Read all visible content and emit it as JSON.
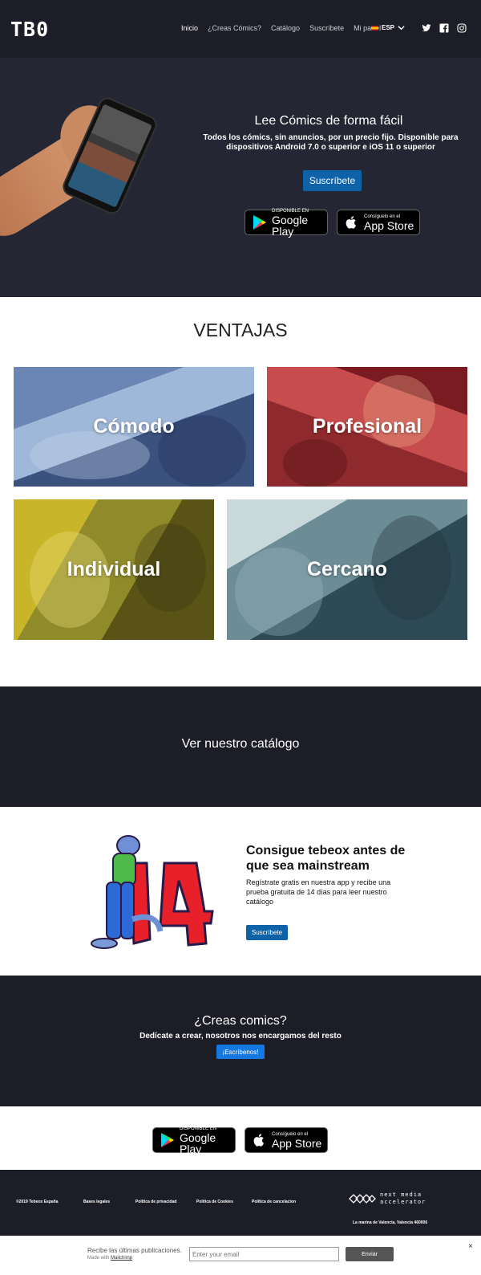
{
  "nav": {
    "logo": "TB0",
    "items": [
      "Inicio",
      "¿Creas Cómics?",
      "Catálogo",
      "Suscríbete",
      "Mi panel"
    ],
    "lang": "ESP",
    "social_icons": [
      "twitter-icon",
      "facebook-icon",
      "instagram-icon"
    ]
  },
  "hero": {
    "title": "Lee Cómics de forma fácil",
    "subtitle": "Todos los cómics, sin anuncios, por un precio fijo. Disponible para dispositivos Android 7.0 o superior e iOS 11 o superior",
    "button": "Suscríbete"
  },
  "stores": {
    "google_small": "DISPONIBLE EN",
    "google_big": "Google Play",
    "apple_small": "Consíguelo en el",
    "apple_big": "App Store"
  },
  "ventajas": {
    "title": "VENTAJAS",
    "tiles": [
      "Cómodo",
      "Profesional",
      "Individual",
      "Cercano"
    ]
  },
  "catalog": {
    "link": "Ver nuestro catálogo"
  },
  "trial": {
    "title": "Consigue tebeox antes de que sea mainstream",
    "subtitle": "Regístrate gratis en nuestra app y recibe una prueba gratuita de 14 días para leer nuestro catálogo",
    "button": "Suscríbete"
  },
  "creators": {
    "title": "¿Creas comics?",
    "subtitle": "Dedícate a crear, nosotros nos encargamos del resto",
    "button": "¡Escríbenos!"
  },
  "footer": {
    "links": [
      "©2019 Tebeox España",
      "Bases legales",
      "Política de privacidad",
      "Política de Cookies",
      "Política de cancelacion"
    ],
    "brand_line1": "next media",
    "brand_line2": "accelerator",
    "address": "La marina de Valencia, Valencia 460006"
  },
  "newsletter": {
    "text": "Recibe las últimas publicaciones.",
    "made_with": "Made with",
    "made_with_link": "Mailchimp",
    "placeholder": "Enter your email",
    "button": "Enviar",
    "close": "×"
  }
}
